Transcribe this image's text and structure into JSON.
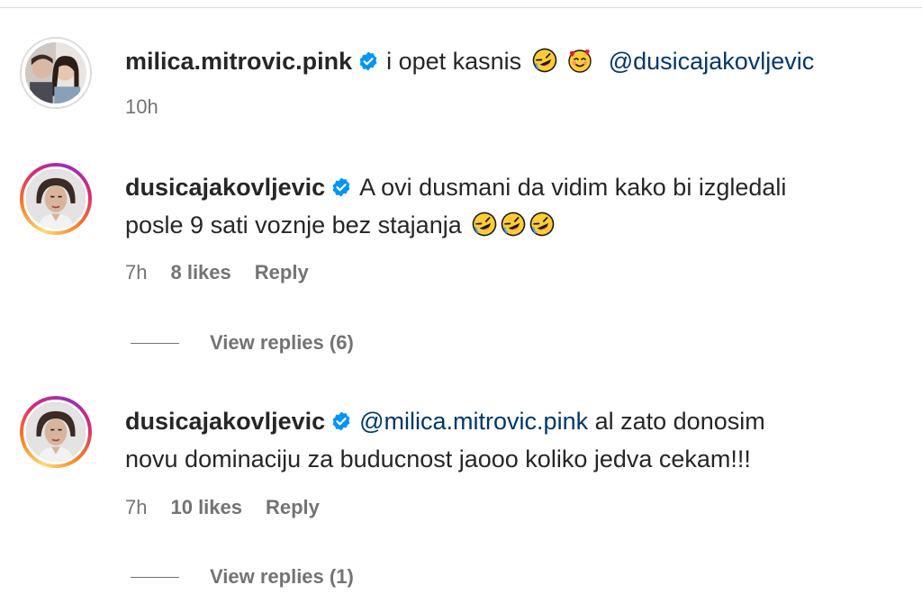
{
  "comments": [
    {
      "username": "milica.mitrovic.pink",
      "text": "i opet kasnis",
      "emojis": [
        "rofl-emoji",
        "smiling-face-with-hearts-emoji"
      ],
      "mention_after": "@dusicajakovljevic",
      "time": "10h"
    },
    {
      "username": "dusicajakovljevic",
      "line1": "A ovi dusmani da vidim kako bi izgledali",
      "line2": "posle 9 sati voznje bez stajanja",
      "emojis": [
        "rofl-emoji",
        "rofl-emoji",
        "rofl-emoji"
      ],
      "time": "7h",
      "likes": "8 likes",
      "reply": "Reply",
      "view_replies": "View replies (6)"
    },
    {
      "username": "dusicajakovljevic",
      "mention": "@milica.mitrovic.pink",
      "line1_rest": "al zato donosim",
      "line2": "novu dominaciju za buducnost jaooo koliko jedva cekam!!!",
      "time": "7h",
      "likes": "10 likes",
      "reply": "Reply",
      "view_replies": "View replies (1)"
    }
  ],
  "colors": {
    "verified": "#0095f6",
    "mention": "#00376b",
    "secondary_text": "#737373",
    "primary_text": "#262626"
  }
}
